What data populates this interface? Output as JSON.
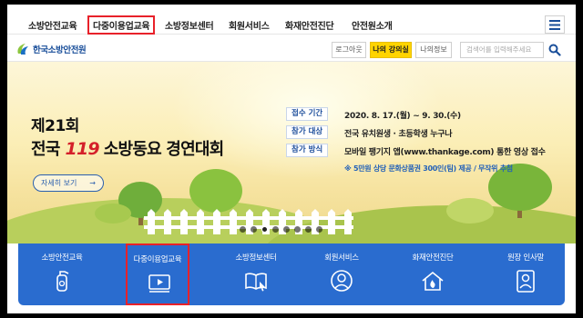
{
  "topnav": {
    "items": [
      "소방안전교육",
      "다중이용업교육",
      "소방정보센터",
      "회원서비스",
      "화재안전진단",
      "안전원소개"
    ]
  },
  "header": {
    "logo_text": "한국소방안전원",
    "logout_label": "로그아웃",
    "my_class_label": "나의 강의실",
    "my_info_label": "나의정보",
    "search_placeholder": "검색어를 입력해주세요"
  },
  "banner": {
    "title_line1": "제21회",
    "title_prefix": "전국",
    "title_119": "119",
    "title_suffix": "소방동요 경연대회",
    "more_label": "자세히 보기",
    "more_arrow": "→",
    "info": [
      {
        "label": "접수 기간",
        "value": "2020. 8. 17.(월) ~ 9. 30.(수)"
      },
      {
        "label": "참가 대상",
        "value": "전국 유치원생 · 초등학생 누구나"
      },
      {
        "label": "참가 방식",
        "value": "모바일 팽기지 앱(www.thankage.com) 통한 영상 접수"
      }
    ],
    "note": "※ 5만원 상당 문화상품권 300인(팀) 제공 / 무작위 추첨",
    "slide_count": 8,
    "active_slide": 2
  },
  "quick": {
    "items": [
      {
        "label": "소방안전교육",
        "icon": "fire-extinguisher-icon"
      },
      {
        "label": "다중이용업교육",
        "icon": "video-play-icon"
      },
      {
        "label": "소방정보센터",
        "icon": "book-cursor-icon"
      },
      {
        "label": "회원서비스",
        "icon": "user-circle-icon"
      },
      {
        "label": "화재안전진단",
        "icon": "fire-house-icon"
      },
      {
        "label": "원장 인사말",
        "icon": "person-badge-icon"
      }
    ]
  },
  "colors": {
    "highlight": "#e8212a",
    "brand_blue": "#2a6ccf",
    "yellow_button": "#ffd400"
  }
}
